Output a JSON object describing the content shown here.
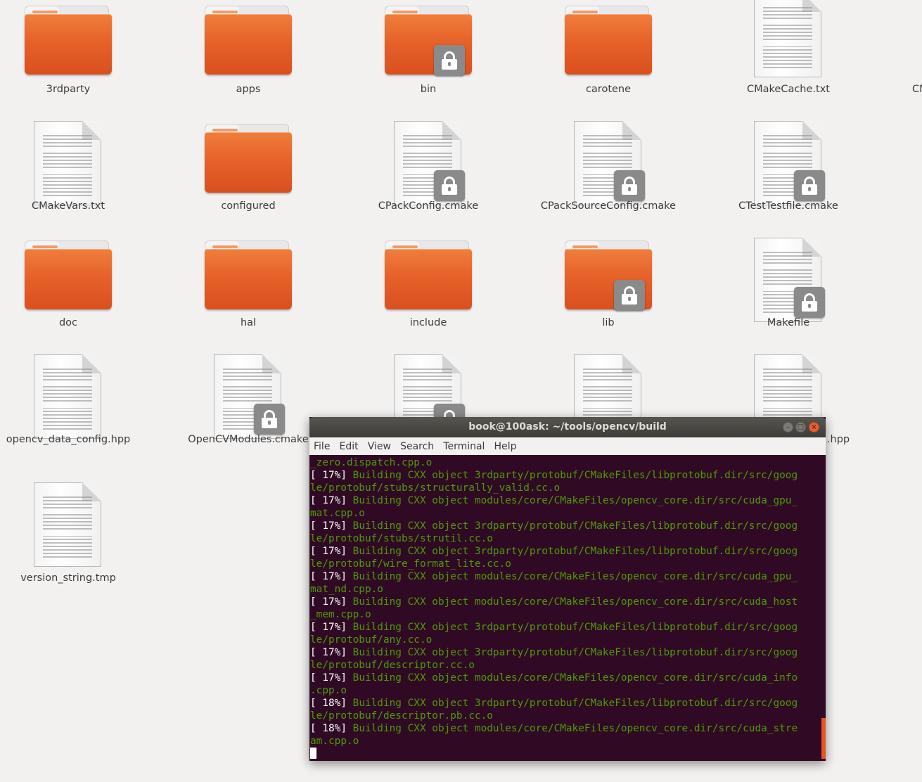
{
  "files": [
    {
      "name": "3rdparty",
      "type": "folder",
      "locked": false
    },
    {
      "name": "apps",
      "type": "folder",
      "locked": false
    },
    {
      "name": "bin",
      "type": "folder",
      "locked": true
    },
    {
      "name": "carotene",
      "type": "folder",
      "locked": false
    },
    {
      "name": "CMakeCache.txt",
      "type": "file",
      "locked": false
    },
    {
      "name": "CMakeVars.txt",
      "type": "file",
      "locked": false
    },
    {
      "name": "configured",
      "type": "folder",
      "locked": false
    },
    {
      "name": "CPackConfig.cmake",
      "type": "file",
      "locked": true
    },
    {
      "name": "CPackSourceConfig.cmake",
      "type": "file",
      "locked": true
    },
    {
      "name": "CTestTestfile.cmake",
      "type": "file",
      "locked": true
    },
    {
      "name": "doc",
      "type": "folder",
      "locked": false
    },
    {
      "name": "hal",
      "type": "folder",
      "locked": false
    },
    {
      "name": "include",
      "type": "folder",
      "locked": false
    },
    {
      "name": "lib",
      "type": "folder",
      "locked": true
    },
    {
      "name": "Makefile",
      "type": "file",
      "locked": true
    },
    {
      "name": "opencv_data_config.hpp",
      "type": "file",
      "locked": false
    },
    {
      "name": "OpenCVModules.cmake",
      "type": "file",
      "locked": true
    },
    {
      "name": "",
      "type": "file",
      "locked": true
    },
    {
      "name": "",
      "type": "file",
      "locked": false
    },
    {
      "name": ".hpp",
      "type": "file",
      "locked": false
    },
    {
      "name": "version_string.tmp",
      "type": "file",
      "locked": false
    },
    {
      "name": "CM",
      "type": "partial",
      "locked": false
    }
  ],
  "terminal": {
    "title": "book@100ask: ~/tools/opencv/build",
    "menu": [
      "File",
      "Edit",
      "View",
      "Search",
      "Terminal",
      "Help"
    ],
    "lines": [
      {
        "prefix": "",
        "text": "_zero.dispatch.cpp.o"
      },
      {
        "prefix": "[ 17%] ",
        "text": "Building CXX object 3rdparty/protobuf/CMakeFiles/libprotobuf.dir/src/goog"
      },
      {
        "prefix": "",
        "text": "le/protobuf/stubs/structurally_valid.cc.o"
      },
      {
        "prefix": "[ 17%] ",
        "text": "Building CXX object modules/core/CMakeFiles/opencv_core.dir/src/cuda_gpu_"
      },
      {
        "prefix": "",
        "text": "mat.cpp.o"
      },
      {
        "prefix": "[ 17%] ",
        "text": "Building CXX object 3rdparty/protobuf/CMakeFiles/libprotobuf.dir/src/goog"
      },
      {
        "prefix": "",
        "text": "le/protobuf/stubs/strutil.cc.o"
      },
      {
        "prefix": "[ 17%] ",
        "text": "Building CXX object 3rdparty/protobuf/CMakeFiles/libprotobuf.dir/src/goog"
      },
      {
        "prefix": "",
        "text": "le/protobuf/wire_format_lite.cc.o"
      },
      {
        "prefix": "[ 17%] ",
        "text": "Building CXX object modules/core/CMakeFiles/opencv_core.dir/src/cuda_gpu_"
      },
      {
        "prefix": "",
        "text": "mat_nd.cpp.o"
      },
      {
        "prefix": "[ 17%] ",
        "text": "Building CXX object modules/core/CMakeFiles/opencv_core.dir/src/cuda_host"
      },
      {
        "prefix": "",
        "text": "_mem.cpp.o"
      },
      {
        "prefix": "[ 17%] ",
        "text": "Building CXX object 3rdparty/protobuf/CMakeFiles/libprotobuf.dir/src/goog"
      },
      {
        "prefix": "",
        "text": "le/protobuf/any.cc.o"
      },
      {
        "prefix": "[ 17%] ",
        "text": "Building CXX object 3rdparty/protobuf/CMakeFiles/libprotobuf.dir/src/goog"
      },
      {
        "prefix": "",
        "text": "le/protobuf/descriptor.cc.o"
      },
      {
        "prefix": "[ 17%] ",
        "text": "Building CXX object modules/core/CMakeFiles/opencv_core.dir/src/cuda_info"
      },
      {
        "prefix": "",
        "text": ".cpp.o"
      },
      {
        "prefix": "[ 18%] ",
        "text": "Building CXX object 3rdparty/protobuf/CMakeFiles/libprotobuf.dir/src/goog"
      },
      {
        "prefix": "",
        "text": "le/protobuf/descriptor.pb.cc.o"
      },
      {
        "prefix": "[ 18%] ",
        "text": "Building CXX object modules/core/CMakeFiles/opencv_core.dir/src/cuda_stre"
      },
      {
        "prefix": "",
        "text": "am.cpp.o"
      }
    ]
  }
}
